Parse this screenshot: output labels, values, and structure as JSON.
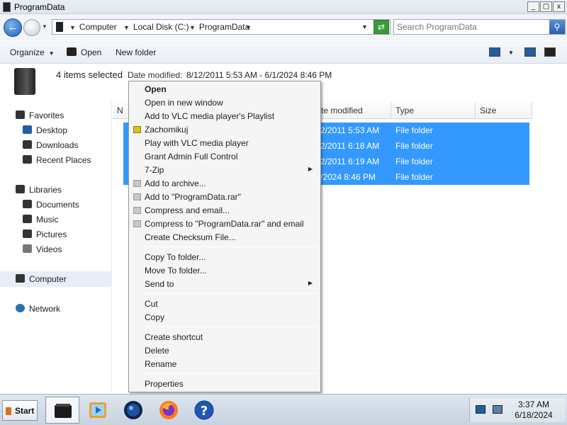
{
  "window": {
    "title": "ProgramData",
    "minimize_label": "_",
    "maximize_label": "▢",
    "close_label": "x"
  },
  "address": {
    "crumbs": [
      "Computer",
      "Local Disk (C:)",
      "ProgramData"
    ],
    "search_placeholder": "Search ProgramData"
  },
  "toolbar": {
    "organize_label": "Organize",
    "open_label": "Open",
    "new_folder_label": "New folder"
  },
  "details": {
    "selection_count": "4 items selected",
    "date_modified_label": "Date modified:",
    "date_modified_value": "8/12/2011 5:53 AM - 6/1/2024 8:46 PM"
  },
  "navpane": {
    "favorites": "Favorites",
    "desktop": "Desktop",
    "downloads": "Downloads",
    "recent_places": "Recent Places",
    "libraries": "Libraries",
    "documents": "Documents",
    "music": "Music",
    "pictures": "Pictures",
    "videos": "Videos",
    "computer": "Computer",
    "network": "Network"
  },
  "filelist": {
    "columns": {
      "name": "N",
      "date_modified": "te modified",
      "type": "Type",
      "size": "Size"
    },
    "rows": [
      {
        "date": "2/2011 5:53 AM",
        "type": "File folder"
      },
      {
        "date": "2/2011 6:18 AM",
        "type": "File folder"
      },
      {
        "date": "2/2011 6:19 AM",
        "type": "File folder"
      },
      {
        "date": "/2024 8:46 PM",
        "type": "File folder"
      }
    ]
  },
  "context_menu": {
    "open": "Open",
    "open_new_window": "Open in new window",
    "add_vlc_playlist": "Add to VLC media player's Playlist",
    "zachomikuj": "Zachomikuj",
    "play_vlc": "Play with VLC media player",
    "grant_admin": "Grant Admin Full Control",
    "seven_zip": "7-Zip",
    "add_archive": "Add to archive...",
    "add_rar": "Add to \"ProgramData.rar\"",
    "compress_email": "Compress and email...",
    "compress_rar_email": "Compress to \"ProgramData.rar\" and email",
    "checksum": "Create Checksum File...",
    "copy_to": "Copy To folder...",
    "move_to": "Move To folder...",
    "send_to": "Send to",
    "cut": "Cut",
    "copy": "Copy",
    "create_shortcut": "Create shortcut",
    "delete": "Delete",
    "rename": "Rename",
    "properties": "Properties"
  },
  "taskbar": {
    "start_label": "Start",
    "help_glyph": "?",
    "time": "3:37 AM",
    "date": "6/18/2024"
  },
  "icons": {
    "back": "back-arrow-icon",
    "forward": "forward-arrow-icon",
    "refresh": "refresh-icon",
    "search": "search-icon"
  }
}
